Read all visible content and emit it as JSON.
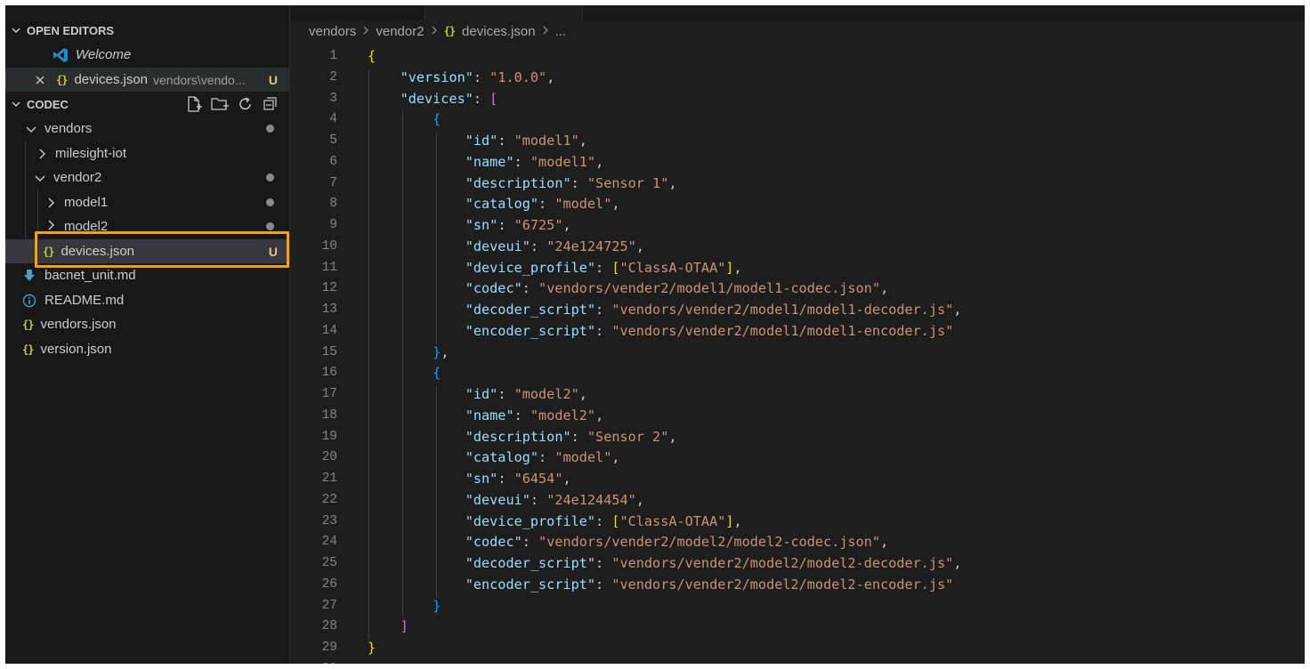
{
  "explorer": {
    "open_editors": {
      "title": "OPEN EDITORS",
      "items": [
        {
          "label": "Welcome",
          "desc": ""
        },
        {
          "label": "devices.json",
          "desc": "vendors\\vendo...",
          "status": "U"
        }
      ]
    },
    "folder": {
      "title": "CODEC",
      "items": [
        {
          "label": "vendors"
        },
        {
          "label": "milesight-iot"
        },
        {
          "label": "vendor2"
        },
        {
          "label": "model1"
        },
        {
          "label": "model2"
        },
        {
          "label": "devices.json",
          "status": "U"
        },
        {
          "label": "bacnet_unit.md"
        },
        {
          "label": "README.md"
        },
        {
          "label": "vendors.json"
        },
        {
          "label": "version.json"
        }
      ]
    }
  },
  "breadcrumb": [
    "vendors",
    "vendor2",
    "devices.json",
    "..."
  ],
  "editor": {
    "lines": [
      [
        [
          "b1",
          "{"
        ]
      ],
      [
        [
          "p",
          "    "
        ],
        [
          "k",
          "\"version\""
        ],
        [
          "p",
          ": "
        ],
        [
          "s",
          "\"1.0.0\""
        ],
        [
          "p",
          ","
        ]
      ],
      [
        [
          "p",
          "    "
        ],
        [
          "k",
          "\"devices\""
        ],
        [
          "p",
          ": "
        ],
        [
          "b2",
          "["
        ]
      ],
      [
        [
          "p",
          "        "
        ],
        [
          "b3",
          "{"
        ]
      ],
      [
        [
          "p",
          "            "
        ],
        [
          "k",
          "\"id\""
        ],
        [
          "p",
          ": "
        ],
        [
          "s",
          "\"model1\""
        ],
        [
          "p",
          ","
        ]
      ],
      [
        [
          "p",
          "            "
        ],
        [
          "k",
          "\"name\""
        ],
        [
          "p",
          ": "
        ],
        [
          "s",
          "\"model1\""
        ],
        [
          "p",
          ","
        ]
      ],
      [
        [
          "p",
          "            "
        ],
        [
          "k",
          "\"description\""
        ],
        [
          "p",
          ": "
        ],
        [
          "s",
          "\"Sensor 1\""
        ],
        [
          "p",
          ","
        ]
      ],
      [
        [
          "p",
          "            "
        ],
        [
          "k",
          "\"catalog\""
        ],
        [
          "p",
          ": "
        ],
        [
          "s",
          "\"model\""
        ],
        [
          "p",
          ","
        ]
      ],
      [
        [
          "p",
          "            "
        ],
        [
          "k",
          "\"sn\""
        ],
        [
          "p",
          ": "
        ],
        [
          "s",
          "\"6725\""
        ],
        [
          "p",
          ","
        ]
      ],
      [
        [
          "p",
          "            "
        ],
        [
          "k",
          "\"deveui\""
        ],
        [
          "p",
          ": "
        ],
        [
          "s",
          "\"24e124725\""
        ],
        [
          "p",
          ","
        ]
      ],
      [
        [
          "p",
          "            "
        ],
        [
          "k",
          "\"device_profile\""
        ],
        [
          "p",
          ": "
        ],
        [
          "b1",
          "["
        ],
        [
          "s",
          "\"ClassA-OTAA\""
        ],
        [
          "b1",
          "]"
        ],
        [
          "p",
          ","
        ]
      ],
      [
        [
          "p",
          "            "
        ],
        [
          "k",
          "\"codec\""
        ],
        [
          "p",
          ": "
        ],
        [
          "s",
          "\"vendors/vender2/model1/model1-codec.json\""
        ],
        [
          "p",
          ","
        ]
      ],
      [
        [
          "p",
          "            "
        ],
        [
          "k",
          "\"decoder_script\""
        ],
        [
          "p",
          ": "
        ],
        [
          "s",
          "\"vendors/vender2/model1/model1-decoder.js\""
        ],
        [
          "p",
          ","
        ]
      ],
      [
        [
          "p",
          "            "
        ],
        [
          "k",
          "\"encoder_script\""
        ],
        [
          "p",
          ": "
        ],
        [
          "s",
          "\"vendors/vender2/model1/model1-encoder.js\""
        ]
      ],
      [
        [
          "p",
          "        "
        ],
        [
          "b3",
          "}"
        ],
        [
          "p",
          ","
        ]
      ],
      [
        [
          "p",
          "        "
        ],
        [
          "b3",
          "{"
        ]
      ],
      [
        [
          "p",
          "            "
        ],
        [
          "k",
          "\"id\""
        ],
        [
          "p",
          ": "
        ],
        [
          "s",
          "\"model2\""
        ],
        [
          "p",
          ","
        ]
      ],
      [
        [
          "p",
          "            "
        ],
        [
          "k",
          "\"name\""
        ],
        [
          "p",
          ": "
        ],
        [
          "s",
          "\"model2\""
        ],
        [
          "p",
          ","
        ]
      ],
      [
        [
          "p",
          "            "
        ],
        [
          "k",
          "\"description\""
        ],
        [
          "p",
          ": "
        ],
        [
          "s",
          "\"Sensor 2\""
        ],
        [
          "p",
          ","
        ]
      ],
      [
        [
          "p",
          "            "
        ],
        [
          "k",
          "\"catalog\""
        ],
        [
          "p",
          ": "
        ],
        [
          "s",
          "\"model\""
        ],
        [
          "p",
          ","
        ]
      ],
      [
        [
          "p",
          "            "
        ],
        [
          "k",
          "\"sn\""
        ],
        [
          "p",
          ": "
        ],
        [
          "s",
          "\"6454\""
        ],
        [
          "p",
          ","
        ]
      ],
      [
        [
          "p",
          "            "
        ],
        [
          "k",
          "\"deveui\""
        ],
        [
          "p",
          ": "
        ],
        [
          "s",
          "\"24e124454\""
        ],
        [
          "p",
          ","
        ]
      ],
      [
        [
          "p",
          "            "
        ],
        [
          "k",
          "\"device_profile\""
        ],
        [
          "p",
          ": "
        ],
        [
          "b1",
          "["
        ],
        [
          "s",
          "\"ClassA-OTAA\""
        ],
        [
          "b1",
          "]"
        ],
        [
          "p",
          ","
        ]
      ],
      [
        [
          "p",
          "            "
        ],
        [
          "k",
          "\"codec\""
        ],
        [
          "p",
          ": "
        ],
        [
          "s",
          "\"vendors/vender2/model2/model2-codec.json\""
        ],
        [
          "p",
          ","
        ]
      ],
      [
        [
          "p",
          "            "
        ],
        [
          "k",
          "\"decoder_script\""
        ],
        [
          "p",
          ": "
        ],
        [
          "s",
          "\"vendors/vender2/model2/model2-decoder.js\""
        ],
        [
          "p",
          ","
        ]
      ],
      [
        [
          "p",
          "            "
        ],
        [
          "k",
          "\"encoder_script\""
        ],
        [
          "p",
          ": "
        ],
        [
          "s",
          "\"vendors/vender2/model2/model2-encoder.js\""
        ]
      ],
      [
        [
          "p",
          "        "
        ],
        [
          "b3",
          "}"
        ]
      ],
      [
        [
          "p",
          "    "
        ],
        [
          "b2",
          "]"
        ]
      ],
      [
        [
          "b1",
          "}"
        ]
      ],
      []
    ]
  },
  "colors": {
    "json_key": "#9cdcfe",
    "json_string": "#ce9178",
    "highlight_box": "#f5a300",
    "untracked": "#e2c08d"
  }
}
